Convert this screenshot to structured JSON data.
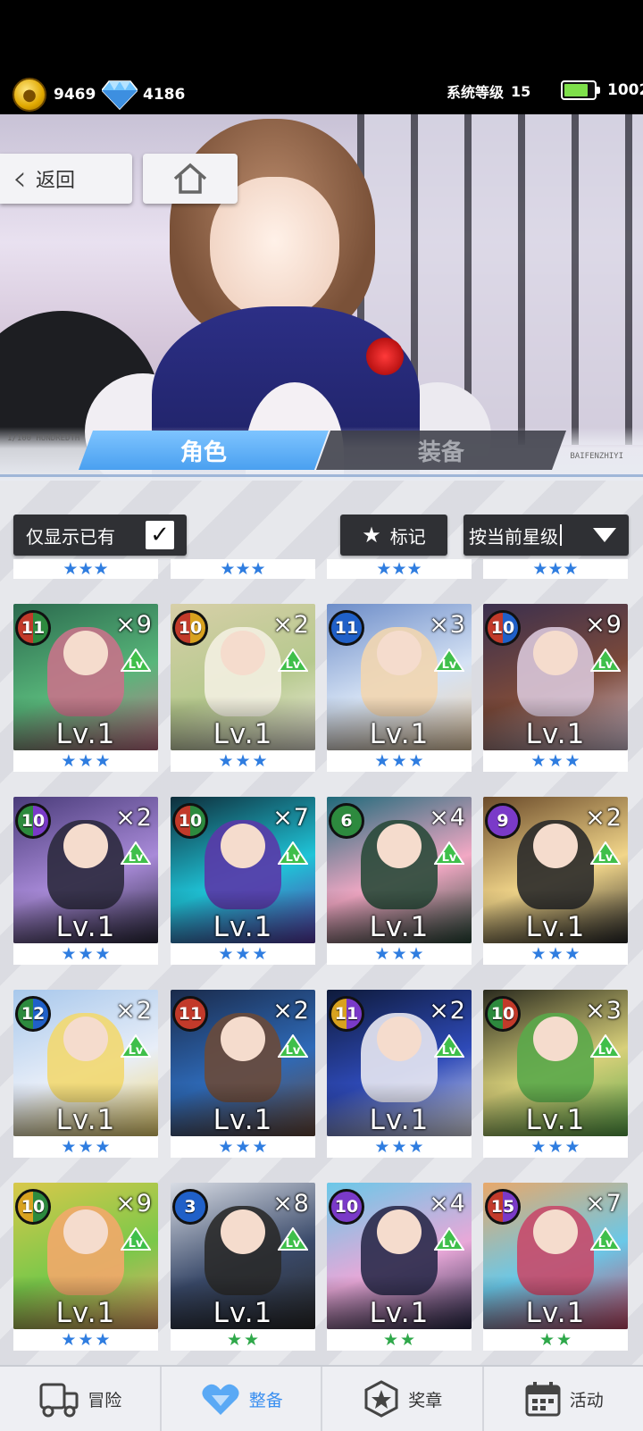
{
  "header": {
    "gold": "9469",
    "diamond": "4186",
    "system_level_label": "系统等级",
    "system_level": "15",
    "energy": "1002",
    "energy_fill": 0.75,
    "gold_icon": "coin-icon",
    "diamond_icon": "diamond-icon"
  },
  "hero": {
    "back_label": "返回",
    "home_icon": "home-icon",
    "tabs": [
      {
        "label": "角色",
        "active": true
      },
      {
        "label": "装备",
        "active": false
      }
    ],
    "deco_left": "1/100\nHUNDREDTH",
    "deco_right": "BAIFENZHIYI"
  },
  "filters": {
    "owned_only_label": "仅显示已有",
    "owned_only_checked": true,
    "mark_label": "标记",
    "sort_label": "按当前星级"
  },
  "cards": [
    {
      "level_badge": "11",
      "badge_color": [
        "#c23a2a",
        "#2d8a3e"
      ],
      "count": "×9",
      "lv": "Lv.1",
      "stars": 3,
      "star_color": "blue",
      "art": [
        "#2b6a4e",
        "#58b67a",
        "#c7738a"
      ]
    },
    {
      "level_badge": "10",
      "badge_color": [
        "#c23a2a",
        "#d8a21f"
      ],
      "count": "×2",
      "lv": "Lv.1",
      "stars": 3,
      "star_color": "blue",
      "art": [
        "#d7cfa8",
        "#b6c98e",
        "#f3efe1"
      ]
    },
    {
      "level_badge": "11",
      "badge_color": [
        "#2060c8",
        "#2060c8"
      ],
      "count": "×3",
      "lv": "Lv.1",
      "stars": 3,
      "star_color": "blue",
      "art": [
        "#6c8cc8",
        "#d5e2f4",
        "#f2d6b0"
      ]
    },
    {
      "level_badge": "10",
      "badge_color": [
        "#c23a2a",
        "#2060c8"
      ],
      "count": "×9",
      "lv": "Lv.1",
      "stars": 3,
      "star_color": "blue",
      "art": [
        "#3a2f4e",
        "#7c4a3a",
        "#d9c7d9"
      ]
    },
    {
      "level_badge": "10",
      "badge_color": [
        "#2d8a3e",
        "#7a3ac8"
      ],
      "count": "×2",
      "lv": "Lv.1",
      "stars": 3,
      "star_color": "blue",
      "art": [
        "#4a3c7a",
        "#a88ad8",
        "#2c2a3e"
      ]
    },
    {
      "level_badge": "10",
      "badge_color": [
        "#c23a2a",
        "#2d8a3e"
      ],
      "count": "×7",
      "lv": "Lv.1",
      "stars": 3,
      "star_color": "blue",
      "art": [
        "#0e2d3a",
        "#1fc4d8",
        "#5a38a8"
      ]
    },
    {
      "level_badge": "6",
      "badge_color": [
        "#2d8a3e",
        "#2d8a3e"
      ],
      "count": "×4",
      "lv": "Lv.1",
      "stars": 3,
      "star_color": "blue",
      "art": [
        "#1f6a7a",
        "#f2a8c4",
        "#2a4a3a"
      ]
    },
    {
      "level_badge": "9",
      "badge_color": [
        "#7a3ac8",
        "#7a3ac8"
      ],
      "count": "×2",
      "lv": "Lv.1",
      "stars": 3,
      "star_color": "blue",
      "art": [
        "#6a4a2a",
        "#f2d68a",
        "#2a2a2a"
      ]
    },
    {
      "level_badge": "12",
      "badge_color": [
        "#2d8a3e",
        "#2060c8"
      ],
      "count": "×2",
      "lv": "Lv.1",
      "stars": 3,
      "star_color": "blue",
      "art": [
        "#a8c8ec",
        "#e8eef8",
        "#f2d870"
      ]
    },
    {
      "level_badge": "11",
      "badge_color": [
        "#c23a2a",
        "#c23a2a"
      ],
      "count": "×2",
      "lv": "Lv.1",
      "stars": 3,
      "star_color": "blue",
      "art": [
        "#1a2a4a",
        "#2e6ab8",
        "#6a4a3a"
      ]
    },
    {
      "level_badge": "11",
      "badge_color": [
        "#d8a21f",
        "#7a3ac8"
      ],
      "count": "×2",
      "lv": "Lv.1",
      "stars": 3,
      "star_color": "blue",
      "art": [
        "#0e1a3a",
        "#2e4ab8",
        "#e8e8f2"
      ]
    },
    {
      "level_badge": "10",
      "badge_color": [
        "#2d8a3e",
        "#c23a2a"
      ],
      "count": "×3",
      "lv": "Lv.1",
      "stars": 3,
      "star_color": "blue",
      "art": [
        "#2a2a1e",
        "#d8d07a",
        "#5aa84a"
      ]
    },
    {
      "level_badge": "10",
      "badge_color": [
        "#d8a21f",
        "#2d8a3e"
      ],
      "count": "×9",
      "lv": "Lv.1",
      "stars": 3,
      "star_color": "blue",
      "art": [
        "#d8c84a",
        "#7ac84a",
        "#f2a86a"
      ]
    },
    {
      "level_badge": "3",
      "badge_color": [
        "#2060c8",
        "#2060c8"
      ],
      "count": "×8",
      "lv": "Lv.1",
      "stars": 2,
      "star_color": "green",
      "art": [
        "#d8dce4",
        "#3a4a6a",
        "#2a2a2a"
      ]
    },
    {
      "level_badge": "10",
      "badge_color": [
        "#7a3ac8",
        "#7a3ac8"
      ],
      "count": "×4",
      "lv": "Lv.1",
      "stars": 2,
      "star_color": "green",
      "art": [
        "#6ac8e8",
        "#e8a8d8",
        "#2a2a4a"
      ]
    },
    {
      "level_badge": "15",
      "badge_color": [
        "#c23a2a",
        "#7a3ac8"
      ],
      "count": "×7",
      "lv": "Lv.1",
      "stars": 2,
      "star_color": "green",
      "art": [
        "#e8a86a",
        "#6ac8e8",
        "#c84a6a"
      ]
    }
  ],
  "partial_row_stars": 3,
  "bottom_nav": [
    {
      "label": "冒险",
      "icon": "truck-icon",
      "active": false
    },
    {
      "label": "整备",
      "icon": "heart-shield-icon",
      "active": true
    },
    {
      "label": "奖章",
      "icon": "medal-icon",
      "active": false
    },
    {
      "label": "活动",
      "icon": "calendar-icon",
      "active": false
    }
  ]
}
